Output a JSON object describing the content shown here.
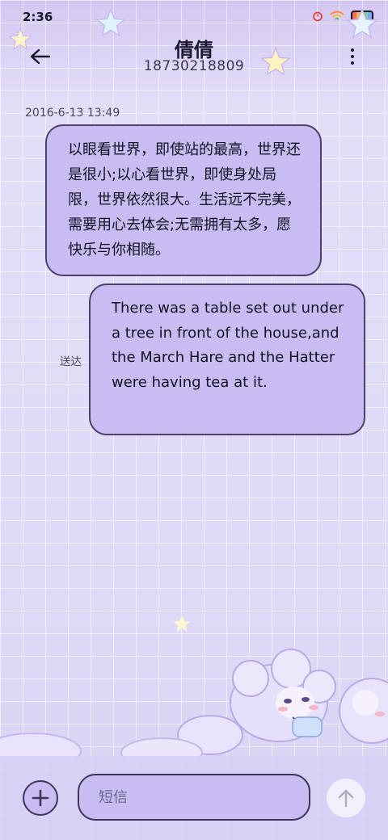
{
  "status_bar": {
    "time": "2:36"
  },
  "header": {
    "contact_name": "倩倩",
    "contact_number": "18730218809"
  },
  "conversation": {
    "timestamp": "2016-6-13 13:49",
    "messages": [
      {
        "direction": "incoming",
        "text": "以眼看世界，即使站的最高，世界还是很小;以心看世界，即使身处局限，世界依然很大。生活远不完美，需要用心去体会;无需拥有太多，愿快乐与你相随。"
      },
      {
        "direction": "outgoing",
        "text": "There was a table set out under a tree in front of the house,and the March Hare and the Hatter were having tea at it.",
        "status": "送达"
      }
    ]
  },
  "composer": {
    "placeholder": "短信",
    "value": ""
  },
  "icons": {
    "back": "arrow-left-icon",
    "more": "more-vertical-icon",
    "add": "plus-icon",
    "send": "arrow-up-icon"
  },
  "colors": {
    "bubble": "#c8bcf2",
    "bubble_border": "#4c4169",
    "background": "#ddd8f6"
  }
}
